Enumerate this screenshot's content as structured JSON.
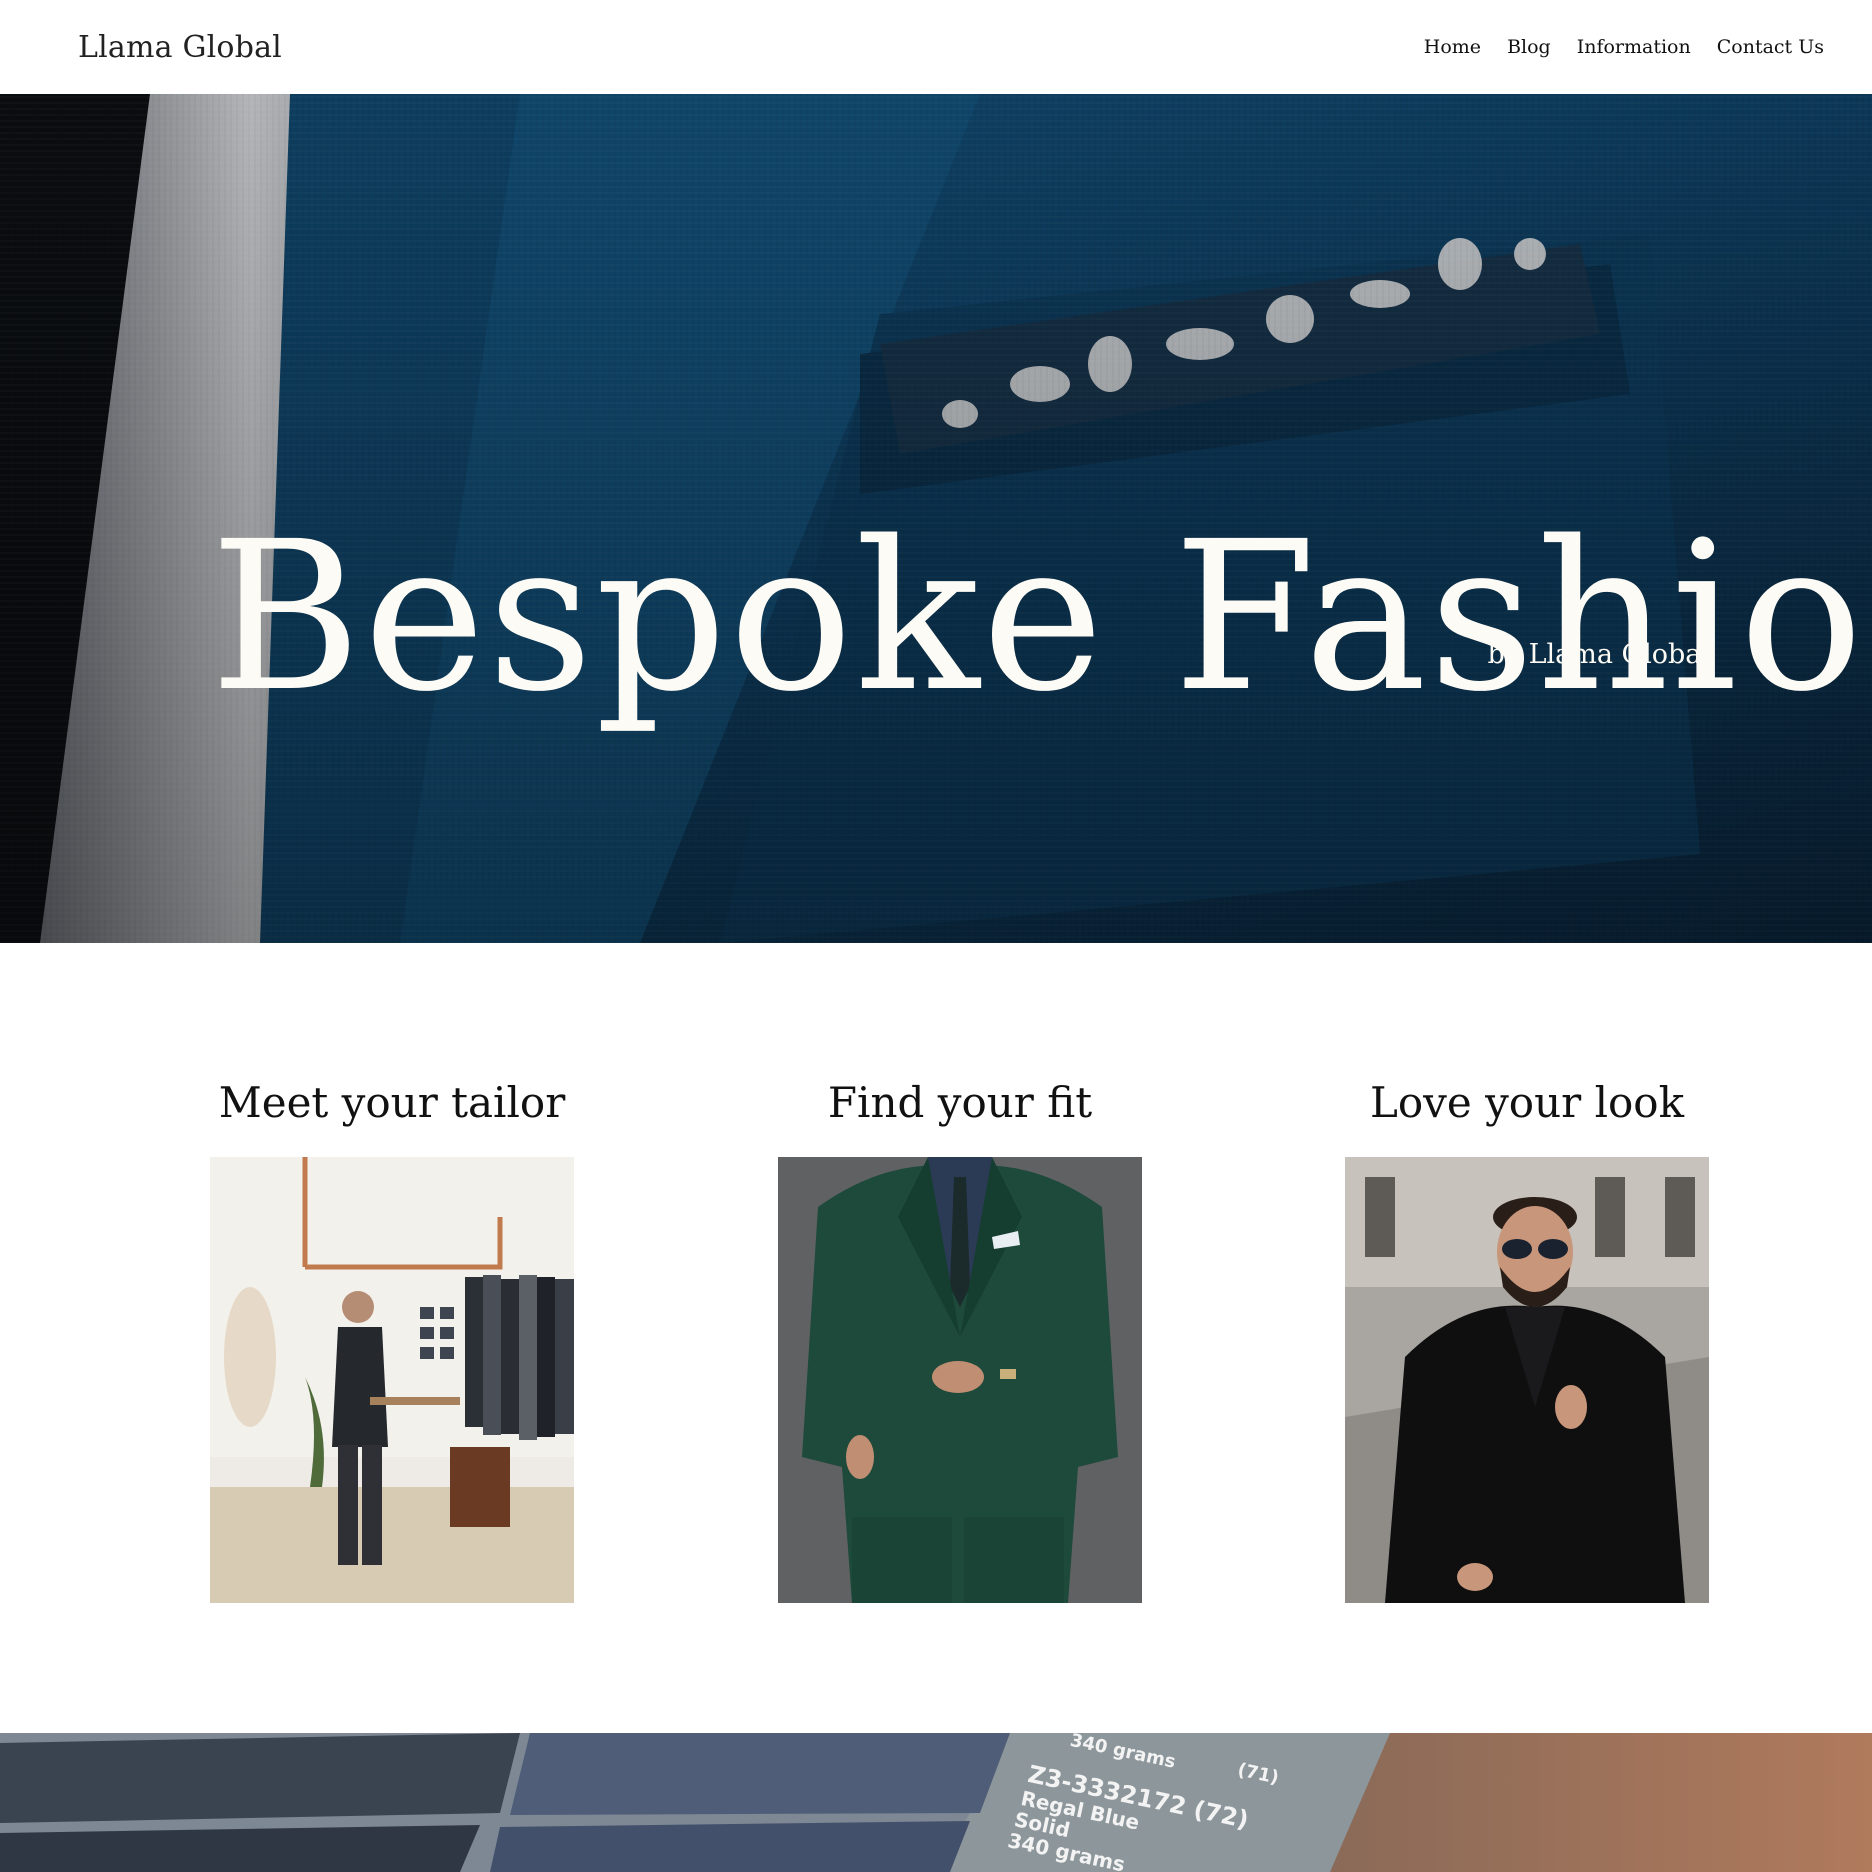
{
  "header": {
    "brand": "Llama Global",
    "nav": [
      "Home",
      "Blog",
      "Information",
      "Contact Us"
    ]
  },
  "hero": {
    "title": "Bespoke Fashion",
    "subtitle": "by Llama Global"
  },
  "features": [
    {
      "title": "Meet your tailor"
    },
    {
      "title": "Find your fit"
    },
    {
      "title": "Love your look"
    }
  ],
  "band": {
    "swatch_code": "Z3-3332172 (72)",
    "swatch_name": "Regal Blue",
    "swatch_pattern": "Solid",
    "swatch_weight": "340 grams",
    "swatch_weight_top": "340 grams",
    "swatch_code_top": "(71)"
  },
  "colors": {
    "hero_blue": "#0f4a70",
    "suit_green": "#1d4a3a",
    "text_light": "#fdfbf5"
  }
}
